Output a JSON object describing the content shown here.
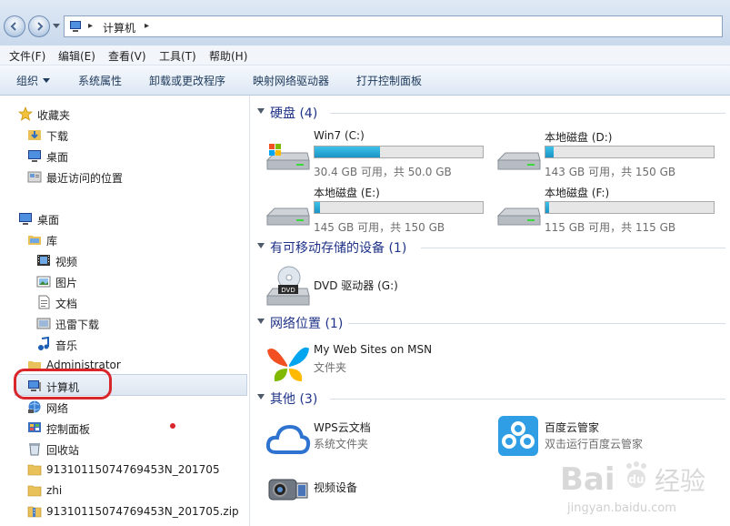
{
  "address": {
    "breadcrumb": "计算机"
  },
  "menu": [
    "文件(F)",
    "编辑(E)",
    "查看(V)",
    "工具(T)",
    "帮助(H)"
  ],
  "toolbar": [
    "组织",
    "系统属性",
    "卸载或更改程序",
    "映射网络驱动器",
    "打开控制面板"
  ],
  "nav": {
    "favorites": {
      "label": "收藏夹",
      "items": [
        "下载",
        "桌面",
        "最近访问的位置"
      ]
    },
    "desktop": "桌面",
    "library": {
      "label": "库",
      "items": [
        "视频",
        "图片",
        "文档",
        "迅雷下载",
        "音乐"
      ]
    },
    "administrator": "Administrator",
    "computer": "计算机",
    "network": "网络",
    "control_panel": "控制面板",
    "recycle": "回收站",
    "folders": [
      "91310115074769453N_201705",
      "zhi",
      "91310115074769453N_201705.zip"
    ]
  },
  "groups": {
    "hdd": {
      "title": "硬盘 (4)"
    },
    "removable": {
      "title": "有可移动存储的设备 (1)"
    },
    "network": {
      "title": "网络位置 (1)"
    },
    "other": {
      "title": "其他 (3)"
    }
  },
  "drives": [
    {
      "name": "Win7 (C:)",
      "info": "30.4 GB 可用，共 50.0 GB",
      "used_fraction": 0.39
    },
    {
      "name": "本地磁盘 (D:)",
      "info": "143 GB 可用，共 150 GB",
      "used_fraction": 0.05
    },
    {
      "name": "本地磁盘 (E:)",
      "info": "145 GB 可用，共 150 GB",
      "used_fraction": 0.03
    },
    {
      "name": "本地磁盘 (F:)",
      "info": "115 GB 可用，共 115 GB",
      "used_fraction": 0.01
    }
  ],
  "dvd": {
    "name": "DVD 驱动器 (G:)",
    "badge": "DVD"
  },
  "msn": {
    "name": "My Web Sites on MSN",
    "type": "文件夹"
  },
  "others": [
    {
      "name": "WPS云文档",
      "type": "系统文件夹"
    },
    {
      "name": "百度云管家",
      "type": "双击运行百度云管家"
    },
    {
      "name": "视频设备"
    }
  ],
  "watermark": {
    "brand": "Bai",
    "brand2": "经验",
    "url": "jingyan.baidu.com"
  },
  "colors": {
    "accent_blue": "#1e3287",
    "bar_fill": "#26a9d8",
    "highlight_red": "#d9262b"
  }
}
